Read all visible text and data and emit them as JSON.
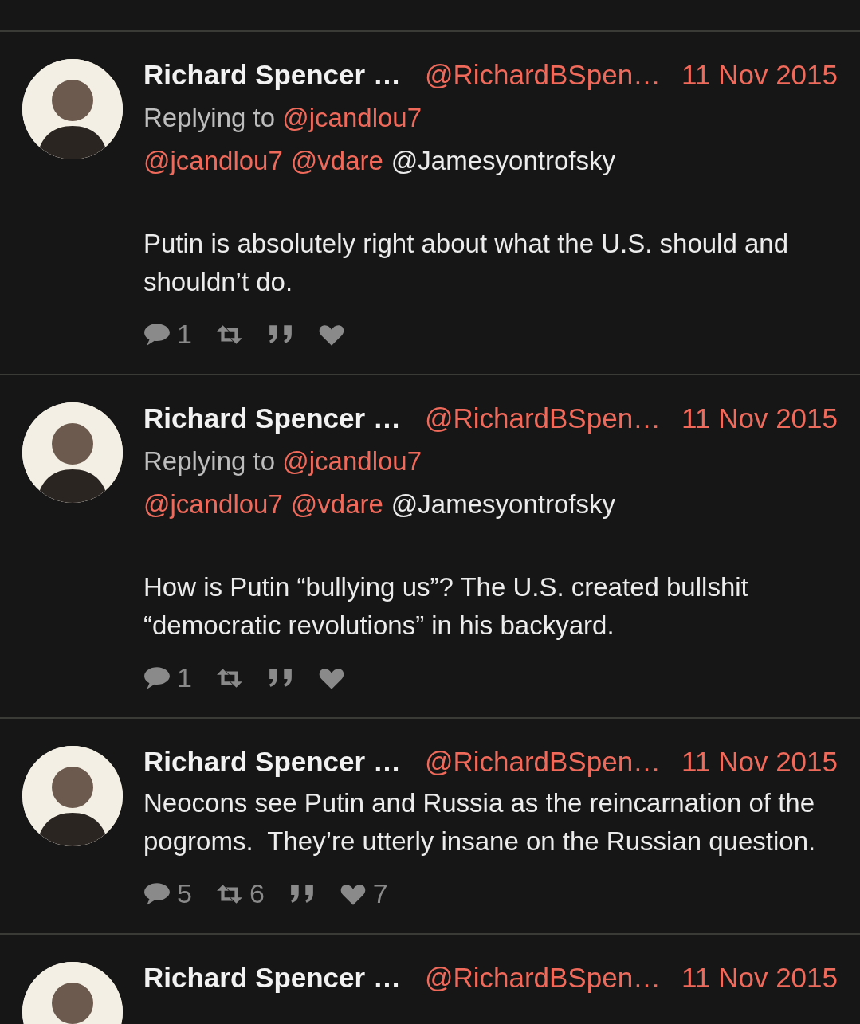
{
  "tweets": [
    {
      "name": "Richard Spencer …",
      "handle": "@RichardBSpen…",
      "date": "11 Nov 2015",
      "replying_to": {
        "label": "Replying to",
        "handle": "@jcandlou7"
      },
      "mentions": [
        {
          "text": "@jcandlou7",
          "linked": true
        },
        {
          "text": "@vdare",
          "linked": true
        },
        {
          "text": "@Jamesyontrofsky",
          "linked": false
        }
      ],
      "text": "Putin is absolutely right about what the U.S. should and shouldn’t do.",
      "actions": [
        {
          "kind": "reply",
          "count": "1"
        },
        {
          "kind": "retweet"
        },
        {
          "kind": "quote"
        },
        {
          "kind": "like"
        }
      ]
    },
    {
      "name": "Richard Spencer …",
      "handle": "@RichardBSpen…",
      "date": "11 Nov 2015",
      "replying_to": {
        "label": "Replying to",
        "handle": "@jcandlou7"
      },
      "mentions": [
        {
          "text": "@jcandlou7",
          "linked": true
        },
        {
          "text": "@vdare",
          "linked": true
        },
        {
          "text": "@Jamesyontrofsky",
          "linked": false
        }
      ],
      "text": "How is Putin “bullying us”? The U.S. created bullshit “democratic revolutions” in his backyard.",
      "actions": [
        {
          "kind": "reply",
          "count": "1"
        },
        {
          "kind": "retweet"
        },
        {
          "kind": "quote"
        },
        {
          "kind": "like"
        }
      ]
    },
    {
      "name": "Richard Spencer …",
      "handle": "@RichardBSpen…",
      "date": "11 Nov 2015",
      "text": "Neocons see Putin and Russia as the reincarnation of the pogroms.  They’re utterly insane on the Russian question.",
      "actions": [
        {
          "kind": "reply",
          "count": "5"
        },
        {
          "kind": "retweet",
          "count": "6"
        },
        {
          "kind": "quote"
        },
        {
          "kind": "like",
          "count": "7"
        }
      ]
    },
    {
      "name": "Richard Spencer …",
      "handle": "@RichardBSpen…",
      "date": "11 Nov 2015"
    }
  ]
}
